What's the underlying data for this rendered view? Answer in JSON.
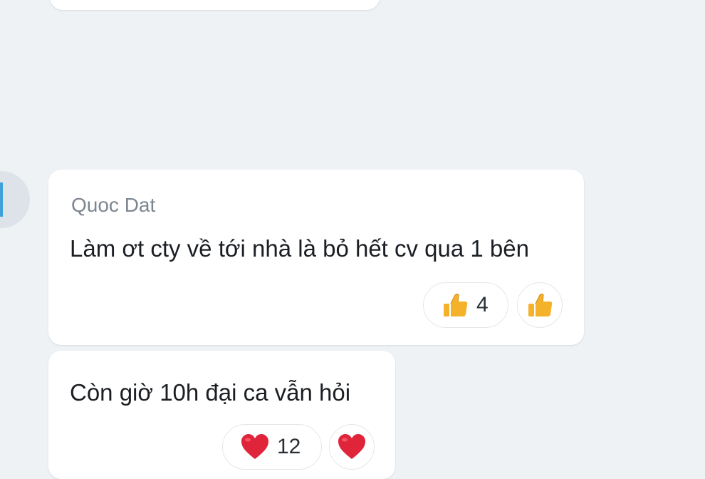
{
  "messages": [
    {
      "sender": "Quoc Dat",
      "text": "Làm ơt cty về tới nhà là bỏ hết cv qua 1 bên",
      "reaction": {
        "icon": "thumbs-up-icon",
        "count": "4"
      }
    },
    {
      "sender": "",
      "text": "Còn giờ 10h đại ca vẫn hỏi",
      "reaction": {
        "icon": "heart-icon",
        "count": "12"
      }
    }
  ],
  "colors": {
    "background": "#eef2f5",
    "bubble": "#ffffff",
    "sender_text": "#7c8691",
    "message_text": "#1b1f24",
    "thumb": "#f3b22a",
    "heart": "#e0243a"
  }
}
